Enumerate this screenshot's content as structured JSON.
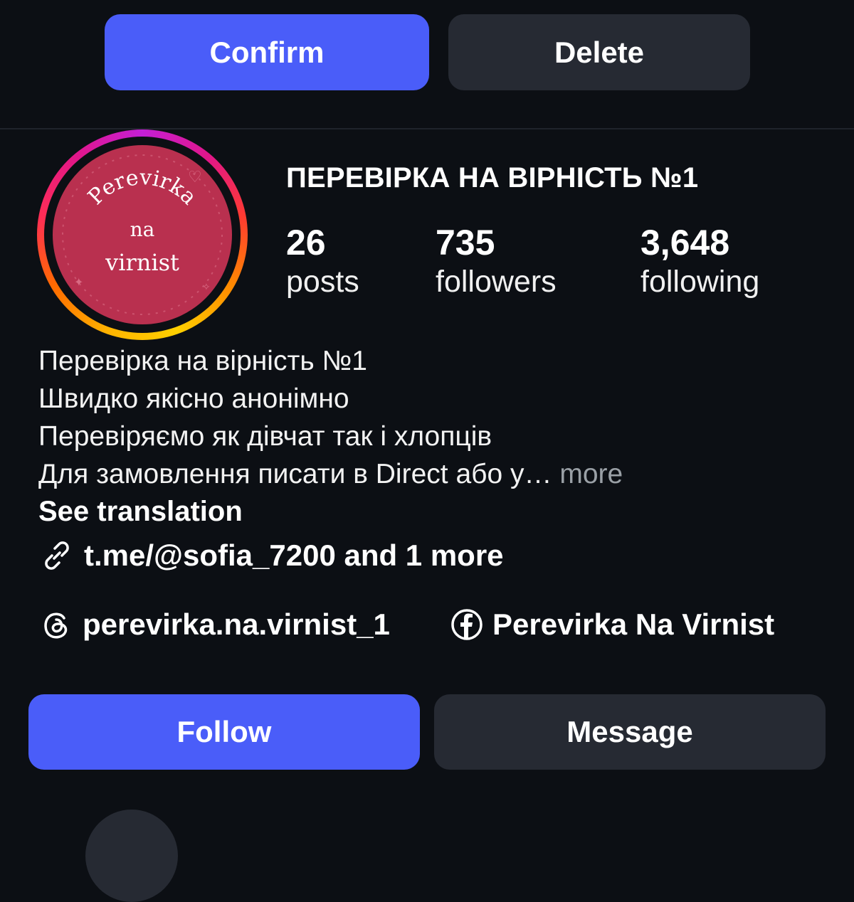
{
  "actions": {
    "confirm_label": "Confirm",
    "delete_label": "Delete"
  },
  "profile": {
    "avatar_text": {
      "line1": "Perevirka",
      "line2": "na",
      "line3": "virnist"
    },
    "name": "ПЕРЕВІРКА НА ВІРНІСТЬ №1",
    "stats": {
      "posts": {
        "value": "26",
        "label": "posts"
      },
      "followers": {
        "value": "735",
        "label": "followers"
      },
      "following": {
        "value": "3,648",
        "label": "following"
      }
    },
    "bio": {
      "line1": "Перевірка на вірність №1",
      "line2": "Швидко якісно анонімно",
      "line3": "Перевіряємо як дівчат так і хлопців",
      "line4": "Для замовлення писати в Direct  або у…",
      "more": "more"
    },
    "see_translation": "See translation",
    "link_text": "t.me/@sofia_7200 and 1 more",
    "threads_handle": "perevirka.na.virnist_1",
    "facebook_name": "Perevirka Na Virnist"
  },
  "buttons": {
    "follow_label": "Follow",
    "message_label": "Message"
  },
  "colors": {
    "primary": "#4a5df9",
    "secondary": "#262a33",
    "background": "#0c0f14",
    "avatar_bg": "#b9304f"
  },
  "icons": [
    "link-icon",
    "threads-icon",
    "facebook-icon"
  ]
}
